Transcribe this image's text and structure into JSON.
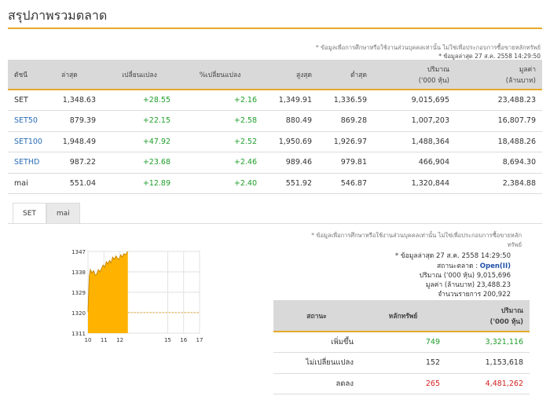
{
  "page": {
    "title": "สรุปภาพรวมตลาด"
  },
  "top_note": {
    "disclaimer": "* ข้อมูลเพื่อการศึกษาหรือใช้งานส่วนบุคคลเท่านั้น ไม่ใช่เพื่อประกอบการซื้อขายหลักทรัพย์",
    "updated": "* ข้อมูลล่าสุด 27 ส.ค. 2558 14:29:50"
  },
  "summary": {
    "headers": {
      "index": "ดัชนี",
      "last": "ล่าสุด",
      "change": "เปลี่ยนแปลง",
      "pct_change": "%เปลี่ยนแปลง",
      "high": "สูงสุด",
      "low": "ต่ำสุด",
      "volume_l1": "ปริมาณ",
      "volume_l2": "('000 หุ้น)",
      "value_l1": "มูลค่า",
      "value_l2": "(ล้านบาท)"
    },
    "rows": [
      {
        "name": "SET",
        "last": "1,348.63",
        "change": "+28.55",
        "pct": "+2.16",
        "high": "1,349.91",
        "low": "1,336.59",
        "volume": "9,015,695",
        "value": "23,488.23"
      },
      {
        "name": "SET50",
        "last": "879.39",
        "change": "+22.15",
        "pct": "+2.58",
        "high": "880.49",
        "low": "869.28",
        "volume": "1,007,203",
        "value": "16,807.79"
      },
      {
        "name": "SET100",
        "last": "1,948.49",
        "change": "+47.92",
        "pct": "+2.52",
        "high": "1,950.69",
        "low": "1,926.97",
        "volume": "1,488,364",
        "value": "18,488.26"
      },
      {
        "name": "SETHD",
        "last": "987.22",
        "change": "+23.68",
        "pct": "+2.46",
        "high": "989.46",
        "low": "979.81",
        "volume": "466,904",
        "value": "8,694.30"
      },
      {
        "name": "mai",
        "last": "551.04",
        "change": "+12.89",
        "pct": "+2.40",
        "high": "551.92",
        "low": "546.87",
        "volume": "1,320,844",
        "value": "2,384.88"
      }
    ]
  },
  "tabs": [
    {
      "label": "SET"
    },
    {
      "label": "mai"
    }
  ],
  "panel_note": {
    "line1": "* ข้อมูลเพื่อการศึกษาหรือใช้งานส่วนบุคคลเท่านั้น ไม่ใช่เพื่อประกอบการซื้อขายหลัก",
    "line2": "ทรัพย์",
    "updated": "* ข้อมูลล่าสุด 27 ส.ค. 2558 14:29:50"
  },
  "market_info": {
    "status_label": "สถานะตลาด :",
    "status_value": "Open(II)",
    "volume_label": "ปริมาณ ('000 หุ้น)",
    "volume_value": "9,015,696",
    "value_label": "มูลค่า (ล้านบาท)",
    "value_value": "23,488.23",
    "trades_label": "จำนวนรายการ",
    "trades_value": "200,922"
  },
  "breadth": {
    "headers": {
      "status": "สถานะ",
      "securities": "หลักทรัพย์",
      "volume_l1": "ปริมาณ",
      "volume_l2": "('000 หุ้น)"
    },
    "rows": [
      {
        "label": "เพิ่มขึ้น",
        "count": "749",
        "volume": "3,321,116"
      },
      {
        "label": "ไม่เปลี่ยนแปลง",
        "count": "152",
        "volume": "1,153,618"
      },
      {
        "label": "ลดลง",
        "count": "265",
        "volume": "4,481,262"
      }
    ]
  },
  "colors": {
    "accent": "#e7a92a",
    "chart_fill": "#ffb300",
    "up": "#1e9e2a",
    "down": "#d42020",
    "link": "#2a6db5"
  },
  "chart_data": {
    "type": "area",
    "x_ticks": [
      "10",
      "11",
      "12",
      "15",
      "16",
      "17"
    ],
    "y_ticks": [
      "1347",
      "1338",
      "1329",
      "1320",
      "1311"
    ],
    "ylim": [
      1311,
      1347
    ],
    "xlim": [
      10,
      17
    ],
    "prev_close": 1320.08,
    "x": [
      10.0,
      10.08,
      10.15,
      10.25,
      10.35,
      10.45,
      10.55,
      10.65,
      10.75,
      10.85,
      10.95,
      11.05,
      11.15,
      11.25,
      11.35,
      11.45,
      11.55,
      11.65,
      11.75,
      11.85,
      11.95,
      12.05,
      12.15,
      12.25,
      12.35,
      12.5
    ],
    "y": [
      1320.5,
      1336.0,
      1339.0,
      1337.5,
      1338.5,
      1336.5,
      1337.0,
      1339.0,
      1338.0,
      1339.5,
      1341.0,
      1340.0,
      1342.5,
      1341.5,
      1343.0,
      1342.0,
      1344.5,
      1343.5,
      1345.0,
      1344.0,
      1343.5,
      1345.5,
      1344.5,
      1346.0,
      1345.5,
      1347.0
    ]
  }
}
